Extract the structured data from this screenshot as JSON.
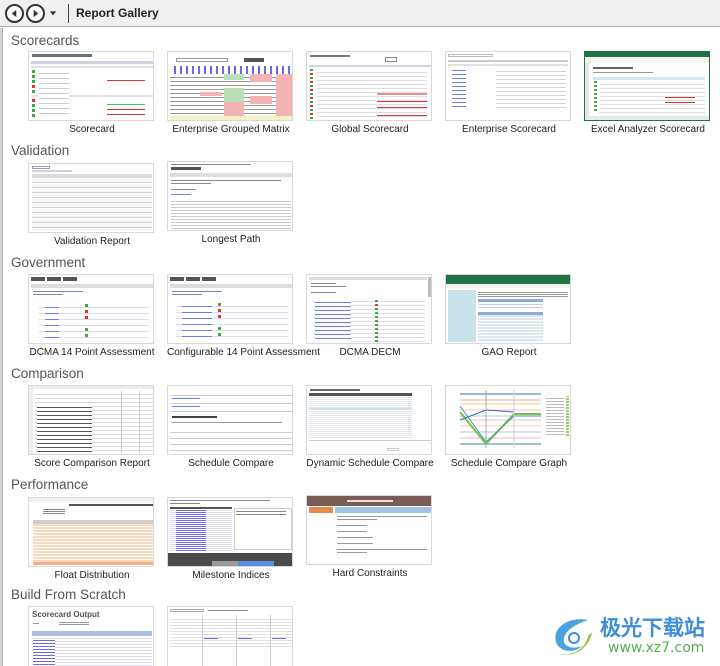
{
  "toolbar": {
    "title": "Report Gallery",
    "back_icon": "back-arrow-icon",
    "forward_icon": "forward-arrow-icon",
    "history_icon": "chevron-down-icon"
  },
  "sections": [
    {
      "title": "Scorecards",
      "items": [
        {
          "label": "Scorecard",
          "thumb_title": "Scorecard: Website Development"
        },
        {
          "label": "Enterprise Grouped Matrix",
          "thumb_title": "Group By: OSM Name"
        },
        {
          "label": "Global Scorecard",
          "thumb_title": "Global Scorecard: ABS/Beta"
        },
        {
          "label": "Enterprise Scorecard",
          "thumb_title": ""
        },
        {
          "label": "Excel Analyzer Scorecard",
          "thumb_title": "Scorecard"
        }
      ]
    },
    {
      "title": "Validation",
      "items": [
        {
          "label": "Validation Report",
          "thumb_title": ""
        },
        {
          "label": "Longest Path",
          "thumb_title": "Longest Path Results"
        }
      ]
    },
    {
      "title": "Government",
      "items": [
        {
          "label": "DCMA 14 Point Assessment",
          "thumb_title": "DCMA 14 Point Assessment Results"
        },
        {
          "label": "Configurable 14 Point Assessment",
          "thumb_title": "14 Point Assessment Results"
        },
        {
          "label": "DCMA DECM",
          "thumb_title": "DECM Results"
        },
        {
          "label": "GAO Report",
          "thumb_title": ""
        }
      ]
    },
    {
      "title": "Comparison",
      "items": [
        {
          "label": "Score Comparison Report",
          "thumb_title": ""
        },
        {
          "label": "Schedule Compare",
          "thumb_title": "Actual Start Date Changed"
        },
        {
          "label": "Dynamic Schedule Compare",
          "thumb_title": "Multiple Schedule Compare Results"
        },
        {
          "label": "Schedule Compare Graph",
          "thumb_title": ""
        }
      ]
    },
    {
      "title": "Performance",
      "items": [
        {
          "label": "Float Distribution",
          "thumb_title": ""
        },
        {
          "label": "Milestone Indices",
          "thumb_title": ""
        },
        {
          "label": "Hard Constraints",
          "thumb_title": "Hard Constraints Report"
        }
      ]
    },
    {
      "title": "Build From Scratch",
      "items": [
        {
          "label": "",
          "thumb_title": "Scorecard Output"
        },
        {
          "label": "",
          "thumb_title": ""
        }
      ]
    }
  ],
  "watermark": {
    "text": "极光下载站",
    "url": "www.xz7.com"
  }
}
